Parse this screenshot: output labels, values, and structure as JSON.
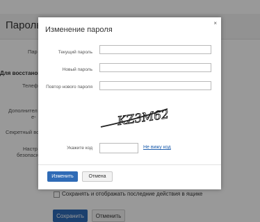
{
  "background": {
    "page_title": "Пароль и",
    "labels": {
      "password": "Пар",
      "section": "Для восстанов",
      "phone": "Телеф",
      "additional_line1": "Дополнител",
      "additional_line2": "е-",
      "secret_question": "Секретный вопр",
      "security_line1": "Настр",
      "security_line2": "безопасно"
    },
    "activity_checkbox_label": "Сохранять и отображать последние действия в ящике",
    "save_button": "Сохранить",
    "cancel_button": "Отменить"
  },
  "modal": {
    "title": "Изменение пароля",
    "close_icon": "×",
    "fields": {
      "current_password": {
        "label": "Текущий пароль",
        "value": ""
      },
      "new_password": {
        "label": "Новый пароль",
        "value": ""
      },
      "repeat_password": {
        "label": "Повтор нового пароля",
        "value": ""
      }
    },
    "captcha": {
      "image_text": "KZ3M62",
      "input_label": "Укажите код",
      "input_value": "",
      "refresh_link": "Не вижу код"
    },
    "buttons": {
      "submit": "Изменить",
      "cancel": "Отмена"
    }
  },
  "colors": {
    "primary_button": "#2f6bb6",
    "link": "#1f5fae",
    "overlay": "rgba(0,0,0,0.40)"
  }
}
